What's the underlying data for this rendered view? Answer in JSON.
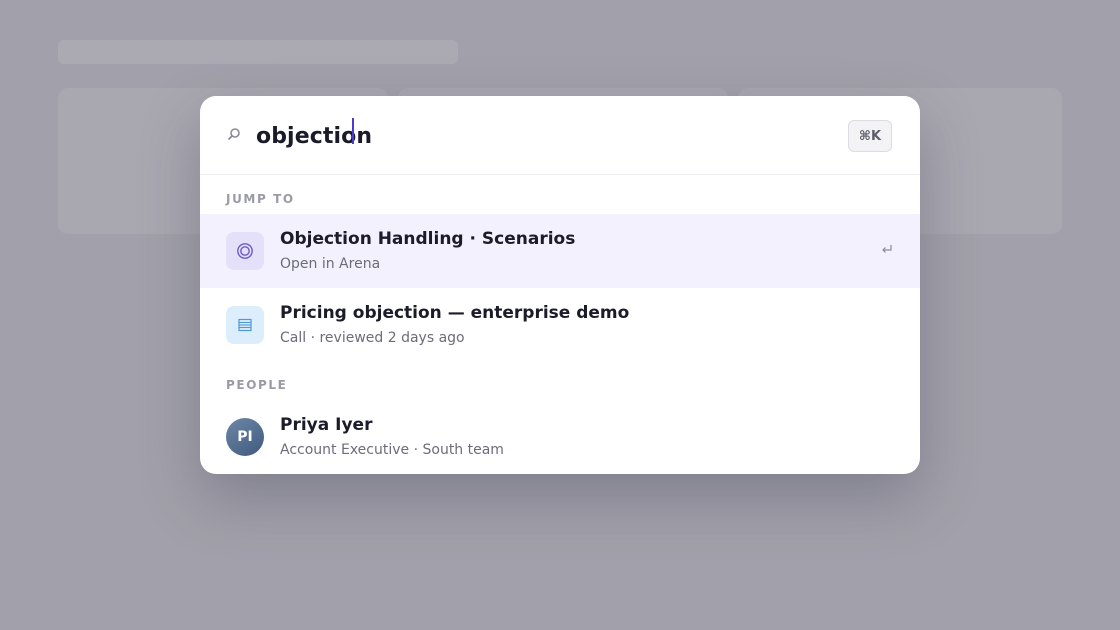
{
  "search": {
    "query": "objection",
    "shortcut": "⌘K",
    "icon": "search-icon"
  },
  "sections": [
    {
      "label": "JUMP TO",
      "items": [
        {
          "title": "Objection Handling · Scenarios",
          "subtitle": "Open in Arena",
          "icon": "scenario-target-icon",
          "icon_color": "#6f5cc4",
          "selected": true
        },
        {
          "title": "Pricing objection — enterprise demo",
          "subtitle": "Call · reviewed 2 days ago",
          "icon": "call-transcript-icon",
          "icon_color": "#4f9ad6",
          "selected": false
        }
      ]
    },
    {
      "label": "PEOPLE",
      "items": [
        {
          "title": "Priya Iyer",
          "subtitle": "Account Executive · South team",
          "initials": "PI",
          "selected": false
        }
      ]
    }
  ],
  "colors": {
    "accent": "#4b3bd1",
    "selected_row": "#f3f1fe",
    "backdrop": "#a2a1ab"
  },
  "hints": {
    "enter_icon": "return-key-icon"
  }
}
